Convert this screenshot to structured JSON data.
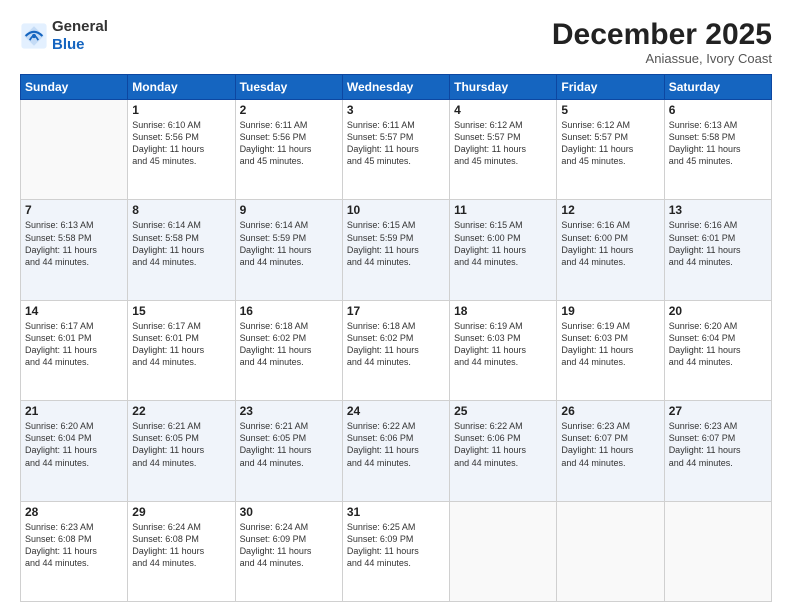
{
  "header": {
    "logo_general": "General",
    "logo_blue": "Blue",
    "month_title": "December 2025",
    "location": "Aniassue, Ivory Coast"
  },
  "weekdays": [
    "Sunday",
    "Monday",
    "Tuesday",
    "Wednesday",
    "Thursday",
    "Friday",
    "Saturday"
  ],
  "weeks": [
    [
      {
        "day": "",
        "info": ""
      },
      {
        "day": "1",
        "info": "Sunrise: 6:10 AM\nSunset: 5:56 PM\nDaylight: 11 hours\nand 45 minutes."
      },
      {
        "day": "2",
        "info": "Sunrise: 6:11 AM\nSunset: 5:56 PM\nDaylight: 11 hours\nand 45 minutes."
      },
      {
        "day": "3",
        "info": "Sunrise: 6:11 AM\nSunset: 5:57 PM\nDaylight: 11 hours\nand 45 minutes."
      },
      {
        "day": "4",
        "info": "Sunrise: 6:12 AM\nSunset: 5:57 PM\nDaylight: 11 hours\nand 45 minutes."
      },
      {
        "day": "5",
        "info": "Sunrise: 6:12 AM\nSunset: 5:57 PM\nDaylight: 11 hours\nand 45 minutes."
      },
      {
        "day": "6",
        "info": "Sunrise: 6:13 AM\nSunset: 5:58 PM\nDaylight: 11 hours\nand 45 minutes."
      }
    ],
    [
      {
        "day": "7",
        "info": "Sunrise: 6:13 AM\nSunset: 5:58 PM\nDaylight: 11 hours\nand 44 minutes."
      },
      {
        "day": "8",
        "info": "Sunrise: 6:14 AM\nSunset: 5:58 PM\nDaylight: 11 hours\nand 44 minutes."
      },
      {
        "day": "9",
        "info": "Sunrise: 6:14 AM\nSunset: 5:59 PM\nDaylight: 11 hours\nand 44 minutes."
      },
      {
        "day": "10",
        "info": "Sunrise: 6:15 AM\nSunset: 5:59 PM\nDaylight: 11 hours\nand 44 minutes."
      },
      {
        "day": "11",
        "info": "Sunrise: 6:15 AM\nSunset: 6:00 PM\nDaylight: 11 hours\nand 44 minutes."
      },
      {
        "day": "12",
        "info": "Sunrise: 6:16 AM\nSunset: 6:00 PM\nDaylight: 11 hours\nand 44 minutes."
      },
      {
        "day": "13",
        "info": "Sunrise: 6:16 AM\nSunset: 6:01 PM\nDaylight: 11 hours\nand 44 minutes."
      }
    ],
    [
      {
        "day": "14",
        "info": "Sunrise: 6:17 AM\nSunset: 6:01 PM\nDaylight: 11 hours\nand 44 minutes."
      },
      {
        "day": "15",
        "info": "Sunrise: 6:17 AM\nSunset: 6:01 PM\nDaylight: 11 hours\nand 44 minutes."
      },
      {
        "day": "16",
        "info": "Sunrise: 6:18 AM\nSunset: 6:02 PM\nDaylight: 11 hours\nand 44 minutes."
      },
      {
        "day": "17",
        "info": "Sunrise: 6:18 AM\nSunset: 6:02 PM\nDaylight: 11 hours\nand 44 minutes."
      },
      {
        "day": "18",
        "info": "Sunrise: 6:19 AM\nSunset: 6:03 PM\nDaylight: 11 hours\nand 44 minutes."
      },
      {
        "day": "19",
        "info": "Sunrise: 6:19 AM\nSunset: 6:03 PM\nDaylight: 11 hours\nand 44 minutes."
      },
      {
        "day": "20",
        "info": "Sunrise: 6:20 AM\nSunset: 6:04 PM\nDaylight: 11 hours\nand 44 minutes."
      }
    ],
    [
      {
        "day": "21",
        "info": "Sunrise: 6:20 AM\nSunset: 6:04 PM\nDaylight: 11 hours\nand 44 minutes."
      },
      {
        "day": "22",
        "info": "Sunrise: 6:21 AM\nSunset: 6:05 PM\nDaylight: 11 hours\nand 44 minutes."
      },
      {
        "day": "23",
        "info": "Sunrise: 6:21 AM\nSunset: 6:05 PM\nDaylight: 11 hours\nand 44 minutes."
      },
      {
        "day": "24",
        "info": "Sunrise: 6:22 AM\nSunset: 6:06 PM\nDaylight: 11 hours\nand 44 minutes."
      },
      {
        "day": "25",
        "info": "Sunrise: 6:22 AM\nSunset: 6:06 PM\nDaylight: 11 hours\nand 44 minutes."
      },
      {
        "day": "26",
        "info": "Sunrise: 6:23 AM\nSunset: 6:07 PM\nDaylight: 11 hours\nand 44 minutes."
      },
      {
        "day": "27",
        "info": "Sunrise: 6:23 AM\nSunset: 6:07 PM\nDaylight: 11 hours\nand 44 minutes."
      }
    ],
    [
      {
        "day": "28",
        "info": "Sunrise: 6:23 AM\nSunset: 6:08 PM\nDaylight: 11 hours\nand 44 minutes."
      },
      {
        "day": "29",
        "info": "Sunrise: 6:24 AM\nSunset: 6:08 PM\nDaylight: 11 hours\nand 44 minutes."
      },
      {
        "day": "30",
        "info": "Sunrise: 6:24 AM\nSunset: 6:09 PM\nDaylight: 11 hours\nand 44 minutes."
      },
      {
        "day": "31",
        "info": "Sunrise: 6:25 AM\nSunset: 6:09 PM\nDaylight: 11 hours\nand 44 minutes."
      },
      {
        "day": "",
        "info": ""
      },
      {
        "day": "",
        "info": ""
      },
      {
        "day": "",
        "info": ""
      }
    ]
  ]
}
